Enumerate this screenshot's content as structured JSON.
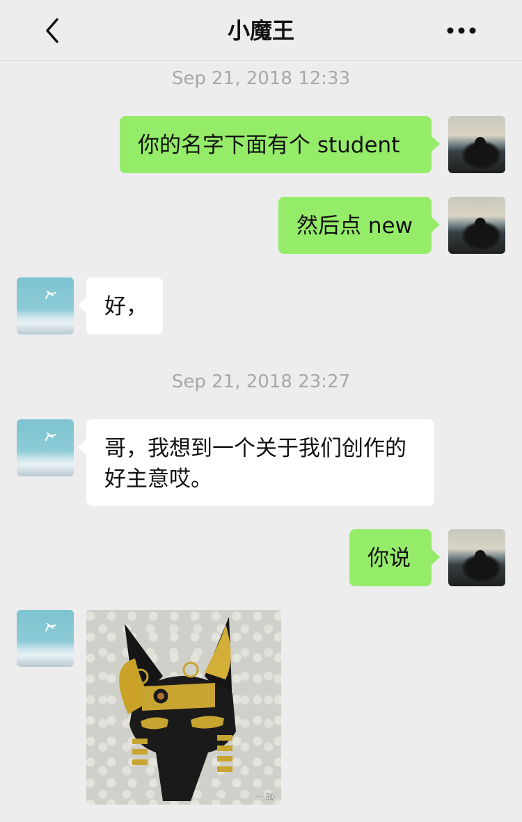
{
  "header": {
    "title": "小魔王"
  },
  "messages": [
    {
      "type": "timestamp",
      "text": "Sep 21, 2018 12:33"
    },
    {
      "type": "me",
      "text": "你的名字下面有个 student"
    },
    {
      "type": "me",
      "text": "然后点 new"
    },
    {
      "type": "other",
      "text": "好，"
    },
    {
      "type": "timestamp",
      "text": "Sep 21, 2018 23:27"
    },
    {
      "type": "other",
      "text": "哥，我想到一个关于我们创作的好主意哎。"
    },
    {
      "type": "me",
      "text": "你说"
    },
    {
      "type": "other-image",
      "image": "anubis-mask-photo",
      "watermark": "··· 冠·"
    }
  ],
  "colors": {
    "background": "#ededed",
    "my_bubble": "#95ec69",
    "other_bubble": "#ffffff",
    "timestamp": "#a8a8a8"
  },
  "icons": {
    "back": "chevron-left-icon",
    "more": "more-dots-icon"
  }
}
